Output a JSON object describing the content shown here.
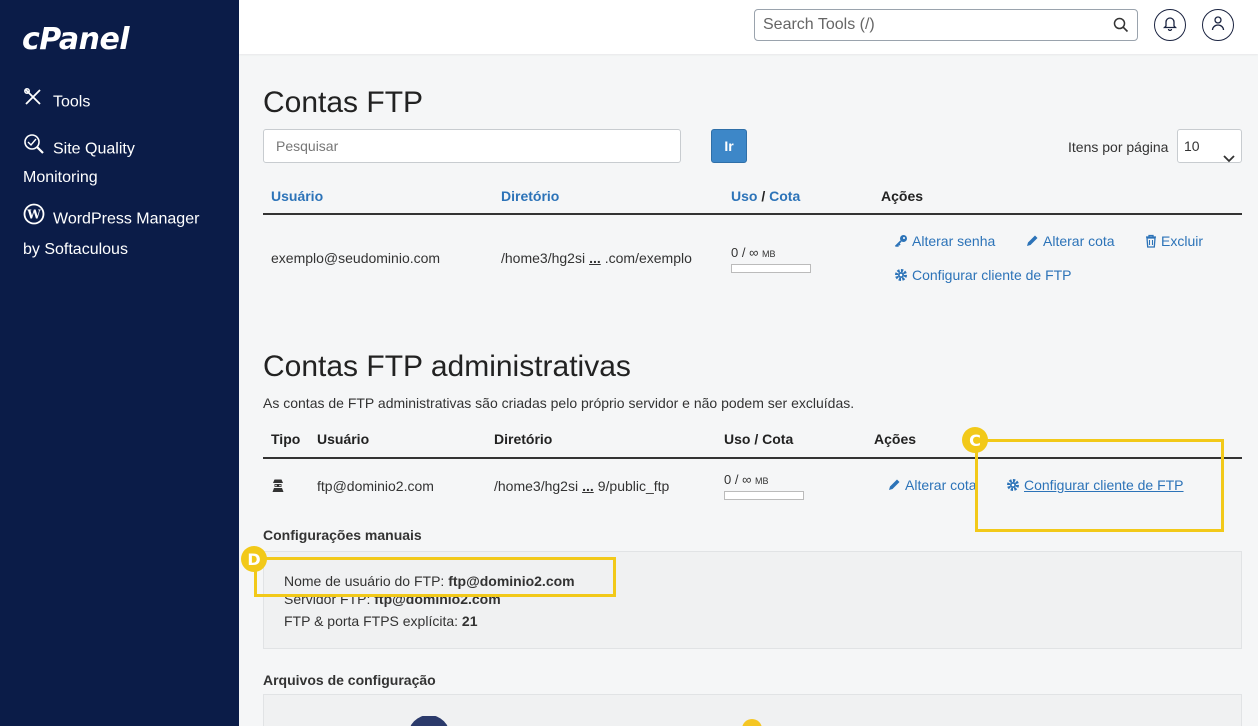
{
  "sidebar": {
    "logo": "cPanel",
    "items": [
      {
        "label": "Tools",
        "icon": "tools-icon"
      },
      {
        "label": "Site Quality Monitoring",
        "label_line1": "Site Quality",
        "label_line2": "Monitoring",
        "icon": "search-quality-icon"
      },
      {
        "label": "WordPress Manager by Softaculous",
        "label_line1": "WordPress Manager",
        "label_line2": "by Softaculous",
        "icon": "wordpress-icon"
      }
    ]
  },
  "header": {
    "search_placeholder": "Search Tools (/)"
  },
  "ftp_accounts": {
    "title": "Contas FTP",
    "search_placeholder": "Pesquisar",
    "go_label": "Ir",
    "per_page_label": "Itens por página",
    "per_page_value": "10",
    "columns": {
      "user": "Usuário",
      "dir": "Diretório",
      "usage": "Uso",
      "slash": "/",
      "quota": "Cota",
      "actions": "Ações"
    },
    "row": {
      "user": "exemplo@seudominio.com",
      "dir_start": "/home3/hg2si",
      "dir_dots": "...",
      "dir_end": ".com/exemplo",
      "quota_used": "0 / ∞",
      "quota_unit": "MB",
      "quota_fraction": 0,
      "actions": {
        "change_password": "Alterar senha",
        "change_quota": "Alterar cota",
        "delete": "Excluir",
        "configure": "Configurar cliente de FTP"
      }
    }
  },
  "admin_accounts": {
    "title": "Contas FTP administrativas",
    "description": "As contas de FTP administrativas são criadas pelo próprio servidor e não podem ser excluídas.",
    "columns": {
      "type": "Tipo",
      "user": "Usuário",
      "dir": "Diretório",
      "usage": "Uso / Cota",
      "actions": "Ações"
    },
    "row": {
      "user": "ftp@dominio2.com",
      "dir_start": "/home3/hg2si",
      "dir_dots": "...",
      "dir_end": "9/public_ftp",
      "quota_used": "0 / ∞",
      "quota_unit": "MB",
      "quota_fraction": 0,
      "actions": {
        "change_quota": "Alterar cota",
        "configure": "Configurar cliente de FTP"
      }
    }
  },
  "manual_settings": {
    "title": "Configurações manuais",
    "username_label": "Nome de usuário do FTP:",
    "username_value": "ftp@dominio2.com",
    "server_label": "Servidor FTP:",
    "server_value": "ftp@dominio2.com",
    "port_label": "FTP & porta FTPS explícita:",
    "port_value": "21"
  },
  "config_files": {
    "title": "Arquivos de configuração"
  },
  "annotations": {
    "c_label": "C",
    "d_label": "D",
    "color": "#f2c919"
  }
}
